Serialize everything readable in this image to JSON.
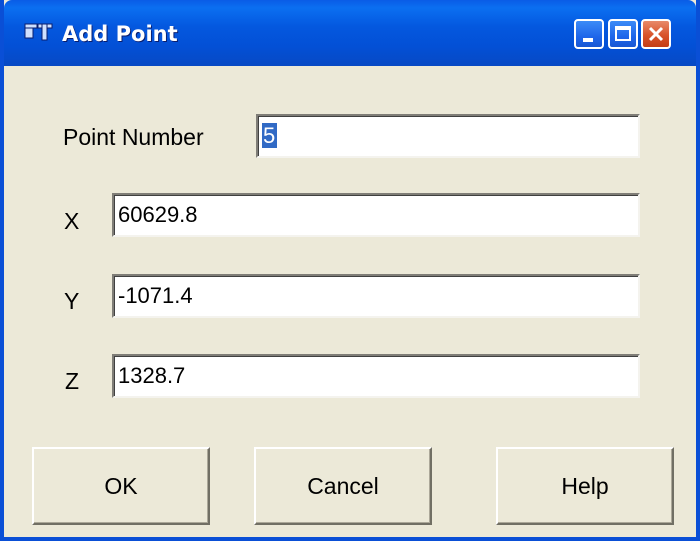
{
  "window": {
    "title": "Add Point",
    "controls": {
      "minimize": "minimize-icon",
      "maximize": "maximize-icon",
      "close": "close-icon"
    }
  },
  "form": {
    "point_number": {
      "label": "Point Number",
      "value": "5"
    },
    "x": {
      "label": "X",
      "value": "60629.8"
    },
    "y": {
      "label": "Y",
      "value": "-1071.4"
    },
    "z": {
      "label": "Z",
      "value": "1328.7"
    }
  },
  "buttons": {
    "ok": "OK",
    "cancel": "Cancel",
    "help": "Help"
  },
  "colors": {
    "titlebar": "#0458df",
    "dialog_bg": "#ece9d8",
    "selection": "#316ac5",
    "close_button": "#d8532a"
  }
}
